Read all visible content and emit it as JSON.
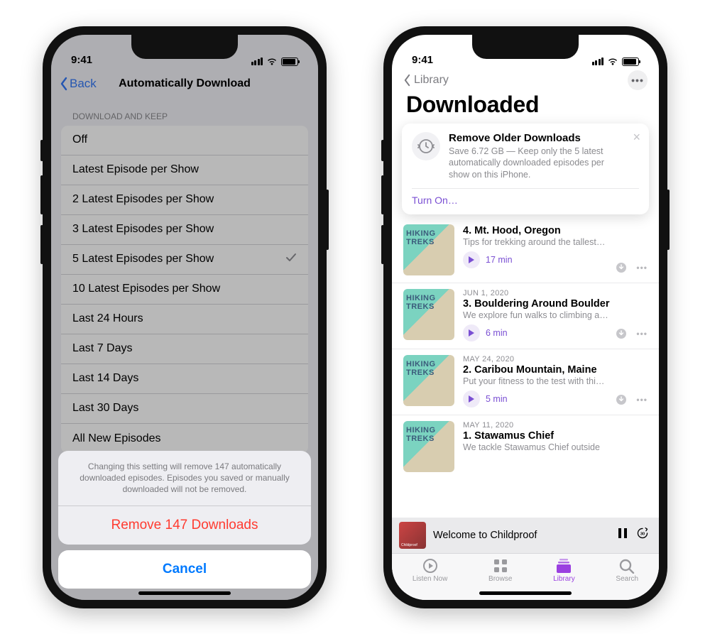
{
  "status": {
    "time": "9:41"
  },
  "phone1": {
    "back": "Back",
    "navTitle": "Automatically Download",
    "sectionHeader": "Download and Keep",
    "options": [
      "Off",
      "Latest Episode per Show",
      "2 Latest Episodes per Show",
      "3 Latest Episodes per Show",
      "5 Latest Episodes per Show",
      "10 Latest Episodes per Show",
      "Last 24 Hours",
      "Last 7 Days",
      "Last 14 Days",
      "Last 30 Days",
      "All New Episodes"
    ],
    "selectedIndex": 4,
    "sheet": {
      "message": "Changing this setting will remove 147 automatically downloaded episodes. Episodes you saved or manually downloaded will not be removed.",
      "destructive": "Remove 147 Downloads",
      "cancel": "Cancel"
    }
  },
  "phone2": {
    "back": "Library",
    "title": "Downloaded",
    "banner": {
      "title": "Remove Older Downloads",
      "desc": "Save 6.72 GB — Keep only the 5 latest automatically downloaded episodes per show on this iPhone.",
      "action": "Turn On…"
    },
    "episodes": [
      {
        "date": "",
        "title": "4. Mt. Hood, Oregon",
        "desc": "Tips for trekking around the tallest…",
        "duration": "17 min"
      },
      {
        "date": "Jun 1, 2020",
        "title": "3. Bouldering Around Boulder",
        "desc": "We explore fun walks to climbing a…",
        "duration": "6 min"
      },
      {
        "date": "May 24, 2020",
        "title": "2. Caribou Mountain, Maine",
        "desc": "Put your fitness to the test with thi…",
        "duration": "5 min"
      },
      {
        "date": "May 11, 2020",
        "title": "1. Stawamus Chief",
        "desc": "We tackle Stawamus Chief outside",
        "duration": ""
      }
    ],
    "nowPlaying": {
      "title": "Welcome to Childproof"
    },
    "tabs": [
      {
        "label": "Listen Now"
      },
      {
        "label": "Browse"
      },
      {
        "label": "Library"
      },
      {
        "label": "Search"
      }
    ],
    "activeTab": 2
  }
}
